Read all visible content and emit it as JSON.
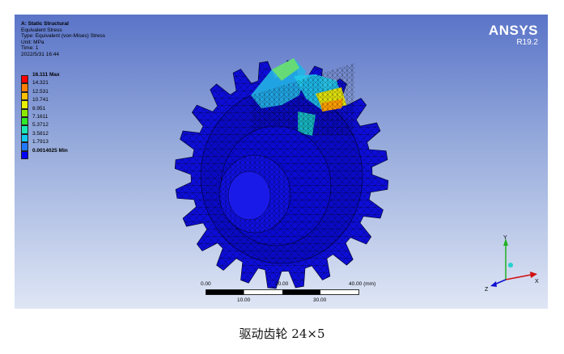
{
  "info": {
    "title": "A: Static Structural",
    "lines": [
      "Equivalent Stress",
      "Type: Equivalent (von-Mises) Stress",
      "Unit: MPa",
      "Time: 1",
      "2022/5/31 16:44"
    ]
  },
  "legend": [
    {
      "label": "16.111 Max",
      "color": "#ff0000",
      "bold": true
    },
    {
      "label": "14.321",
      "color": "#ff7f00"
    },
    {
      "label": "12.531",
      "color": "#ffc000"
    },
    {
      "label": "10.741",
      "color": "#e8f000"
    },
    {
      "label": "8.951",
      "color": "#8de800"
    },
    {
      "label": "7.1611",
      "color": "#2ee82a"
    },
    {
      "label": "5.3712",
      "color": "#19e8b4"
    },
    {
      "label": "3.5812",
      "color": "#11c8f0"
    },
    {
      "label": "1.7913",
      "color": "#1f78ff"
    },
    {
      "label": "0.0014025 Min",
      "color": "#0000ff",
      "bold": true
    }
  ],
  "logo": {
    "name": "ANSYS",
    "version": "R19.2"
  },
  "scale_bar": {
    "top_labels": [
      "0.00",
      "20.00",
      "40.00 (mm)"
    ],
    "bottom_labels": [
      "10.00",
      "30.00"
    ]
  },
  "triad": {
    "x": "X",
    "y": "Y",
    "z": "Z"
  },
  "caption": "驱动齿轮 24×5"
}
